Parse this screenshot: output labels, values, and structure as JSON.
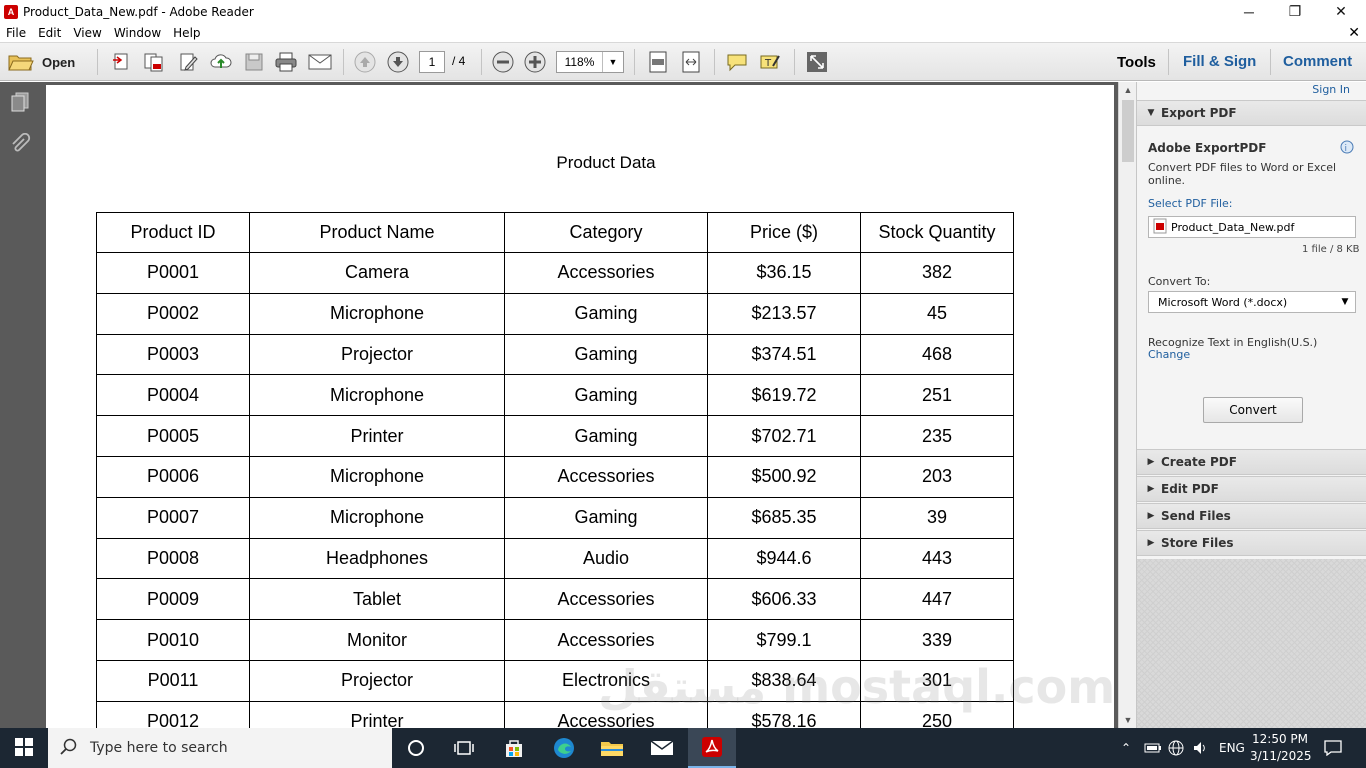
{
  "window": {
    "title": "Product_Data_New.pdf - Adobe Reader",
    "minimize": "─",
    "maximize": "❐",
    "close": "✕"
  },
  "menu": {
    "items": [
      "File",
      "Edit",
      "View",
      "Window",
      "Help"
    ],
    "close_doc": "✕"
  },
  "toolbar": {
    "open_label": "Open",
    "page_current": "1",
    "page_total": "/ 4",
    "zoom": "118%",
    "tools_label": "Tools",
    "fill_sign_label": "Fill & Sign",
    "comment_label": "Comment"
  },
  "document": {
    "title": "Product Data",
    "columns": [
      "Product ID",
      "Product Name",
      "Category",
      "Price ($)",
      "Stock Quantity"
    ],
    "rows": [
      [
        "P0001",
        "Camera",
        "Accessories",
        "$36.15",
        "382"
      ],
      [
        "P0002",
        "Microphone",
        "Gaming",
        "$213.57",
        "45"
      ],
      [
        "P0003",
        "Projector",
        "Gaming",
        "$374.51",
        "468"
      ],
      [
        "P0004",
        "Microphone",
        "Gaming",
        "$619.72",
        "251"
      ],
      [
        "P0005",
        "Printer",
        "Gaming",
        "$702.71",
        "235"
      ],
      [
        "P0006",
        "Microphone",
        "Accessories",
        "$500.92",
        "203"
      ],
      [
        "P0007",
        "Microphone",
        "Gaming",
        "$685.35",
        "39"
      ],
      [
        "P0008",
        "Headphones",
        "Audio",
        "$944.6",
        "443"
      ],
      [
        "P0009",
        "Tablet",
        "Accessories",
        "$606.33",
        "447"
      ],
      [
        "P0010",
        "Monitor",
        "Accessories",
        "$799.1",
        "339"
      ],
      [
        "P0011",
        "Projector",
        "Electronics",
        "$838.64",
        "301"
      ],
      [
        "P0012",
        "Printer",
        "Accessories",
        "$578.16",
        "250"
      ]
    ]
  },
  "panel": {
    "sign_in": "Sign In",
    "export_header": "Export PDF",
    "export_title": "Adobe ExportPDF",
    "export_desc_1": "Convert PDF files to Word or Excel",
    "export_desc_2": "online.",
    "select_label": "Select PDF File:",
    "file_name": "Product_Data_New.pdf",
    "file_info": "1 file / 8 KB",
    "convert_to_label": "Convert To:",
    "convert_to_value": "Microsoft Word (*.docx)",
    "recognize_label": "Recognize Text in English(U.S.)",
    "change_link": "Change",
    "convert_button": "Convert",
    "sections": [
      "Create PDF",
      "Edit PDF",
      "Send Files",
      "Store Files"
    ]
  },
  "taskbar": {
    "search_placeholder": "Type here to search",
    "lang": "ENG",
    "time": "12:50 PM",
    "date": "3/11/2025"
  },
  "watermark": "مستقل mostaql.com",
  "colors": {
    "accent_blue": "#1f5e9e",
    "pdf_red": "#c00000",
    "taskbar": "#1c2733",
    "doc_background": "#5a5a5a"
  }
}
